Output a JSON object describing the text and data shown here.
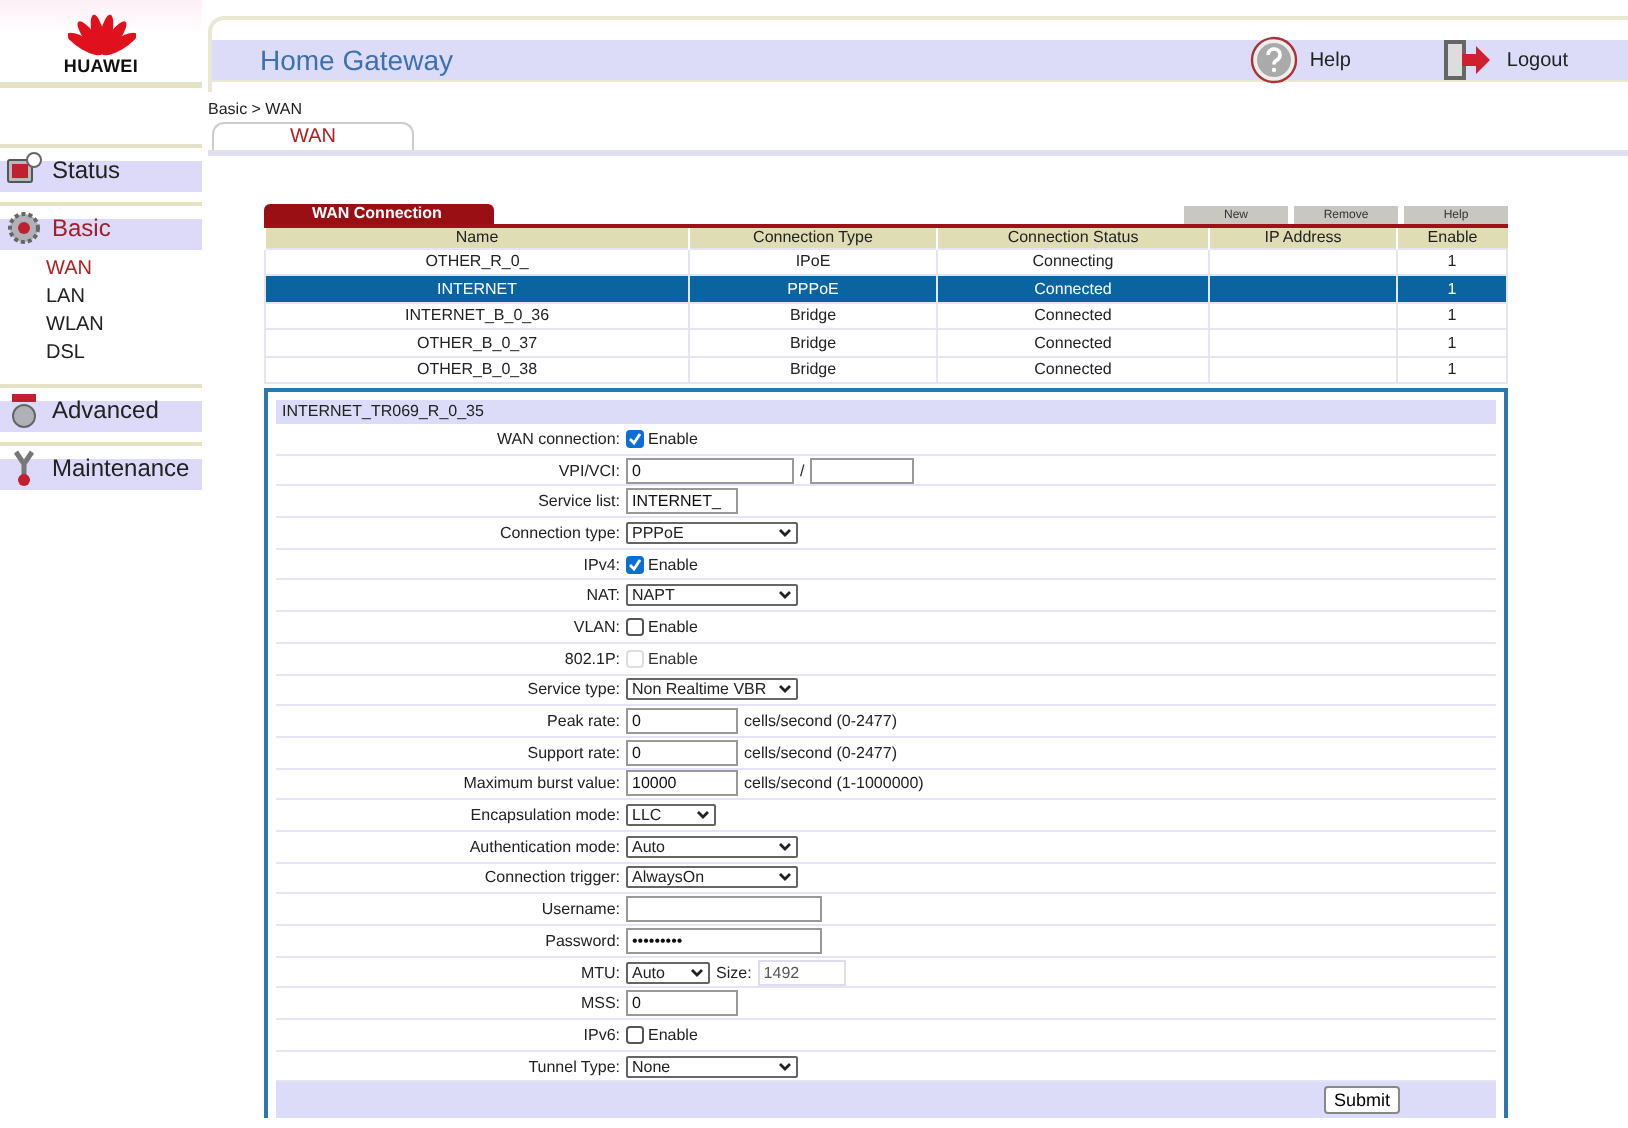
{
  "sidebar": {
    "logo": "HUAWEI",
    "items": [
      {
        "label": "Status",
        "kind": "status",
        "selected": false
      },
      {
        "label": "Basic",
        "kind": "basic",
        "selected": true,
        "children": [
          {
            "label": "WAN",
            "selected": true
          },
          {
            "label": "LAN",
            "selected": false
          },
          {
            "label": "WLAN",
            "selected": false
          },
          {
            "label": "DSL",
            "selected": false
          }
        ]
      },
      {
        "label": "Advanced",
        "kind": "advanced",
        "selected": false
      },
      {
        "label": "Maintenance",
        "kind": "maintenance",
        "selected": false
      }
    ]
  },
  "header": {
    "title": "Home Gateway",
    "actions": [
      {
        "label": "Help",
        "kind": "help"
      },
      {
        "label": "Logout",
        "kind": "logout"
      }
    ]
  },
  "breadcrumb": "Basic > WAN",
  "tabs": [
    {
      "label": "WAN",
      "selected": true
    }
  ],
  "wan_table": {
    "title": "WAN Connection",
    "buttons": [
      "New",
      "Remove",
      "Help"
    ],
    "columns": [
      "Name",
      "Connection Type",
      "Connection Status",
      "IP Address",
      "Enable"
    ],
    "rows": [
      {
        "name": "OTHER_R_0_",
        "type": "IPoE",
        "status": "Connecting",
        "enable": "1",
        "selected": false
      },
      {
        "name": "INTERNET",
        "type": "PPPoE",
        "status": "Connected",
        "enable": "1",
        "selected": true
      },
      {
        "name": "INTERNET_B_0_36",
        "type": "Bridge",
        "status": "Connected",
        "enable": "1",
        "selected": false
      },
      {
        "name": "OTHER_B_0_37",
        "type": "Bridge",
        "status": "Connected",
        "enable": "1",
        "selected": false
      },
      {
        "name": "OTHER_B_0_38",
        "type": "Bridge",
        "status": "Connected",
        "enable": "1",
        "selected": false
      }
    ]
  },
  "form": {
    "title": "INTERNET_TR069_R_0_35",
    "submit": "Submit",
    "fields": [
      {
        "label": "WAN connection:",
        "kind": "checkbox",
        "checked": true,
        "disabled": false,
        "option": "Enable"
      },
      {
        "label": "VPI/VCI:",
        "kind": "pair",
        "value": "0",
        "separator": "/"
      },
      {
        "label": "Service list:",
        "kind": "text",
        "value": "INTERNET_"
      },
      {
        "label": "Connection type:",
        "kind": "select",
        "value": "PPPoE"
      },
      {
        "label": "IPv4:",
        "kind": "checkbox",
        "checked": true,
        "disabled": false,
        "option": "Enable"
      },
      {
        "label": "NAT:",
        "kind": "select",
        "value": "NAPT"
      },
      {
        "label": "VLAN:",
        "kind": "checkbox",
        "checked": false,
        "disabled": false,
        "option": "Enable"
      },
      {
        "label": "802.1P:",
        "kind": "checkbox",
        "checked": false,
        "disabled": true,
        "option": "Enable"
      },
      {
        "label": "Service type:",
        "kind": "select",
        "value": "Non Realtime VBR"
      },
      {
        "label": "Peak rate:",
        "kind": "text",
        "value": "0",
        "hint": "cells/second (0-2477)"
      },
      {
        "label": "Support rate:",
        "kind": "text",
        "value": "0",
        "hint": "cells/second (0-2477)"
      },
      {
        "label": "Maximum burst value:",
        "kind": "text",
        "value": "10000",
        "hint": "cells/second (1-1000000)"
      },
      {
        "label": "Encapsulation mode:",
        "kind": "short_select",
        "value": "LLC"
      },
      {
        "label": "Authentication mode:",
        "kind": "select",
        "value": "Auto"
      },
      {
        "label": "Connection trigger:",
        "kind": "select",
        "value": "AlwaysOn"
      },
      {
        "label": "Username:",
        "kind": "wide_text"
      },
      {
        "label": "Password:",
        "kind": "password",
        "value": "•••••••••"
      },
      {
        "label": "MTU:",
        "kind": "mtu",
        "value": "Auto",
        "size_label": "Size:",
        "size_value": "1492"
      },
      {
        "label": "MSS:",
        "kind": "text",
        "value": "0"
      },
      {
        "label": "IPv6:",
        "kind": "checkbox",
        "checked": false,
        "disabled": false,
        "option": "Enable"
      },
      {
        "label": "Tunnel Type:",
        "kind": "select",
        "value": "None"
      }
    ]
  }
}
